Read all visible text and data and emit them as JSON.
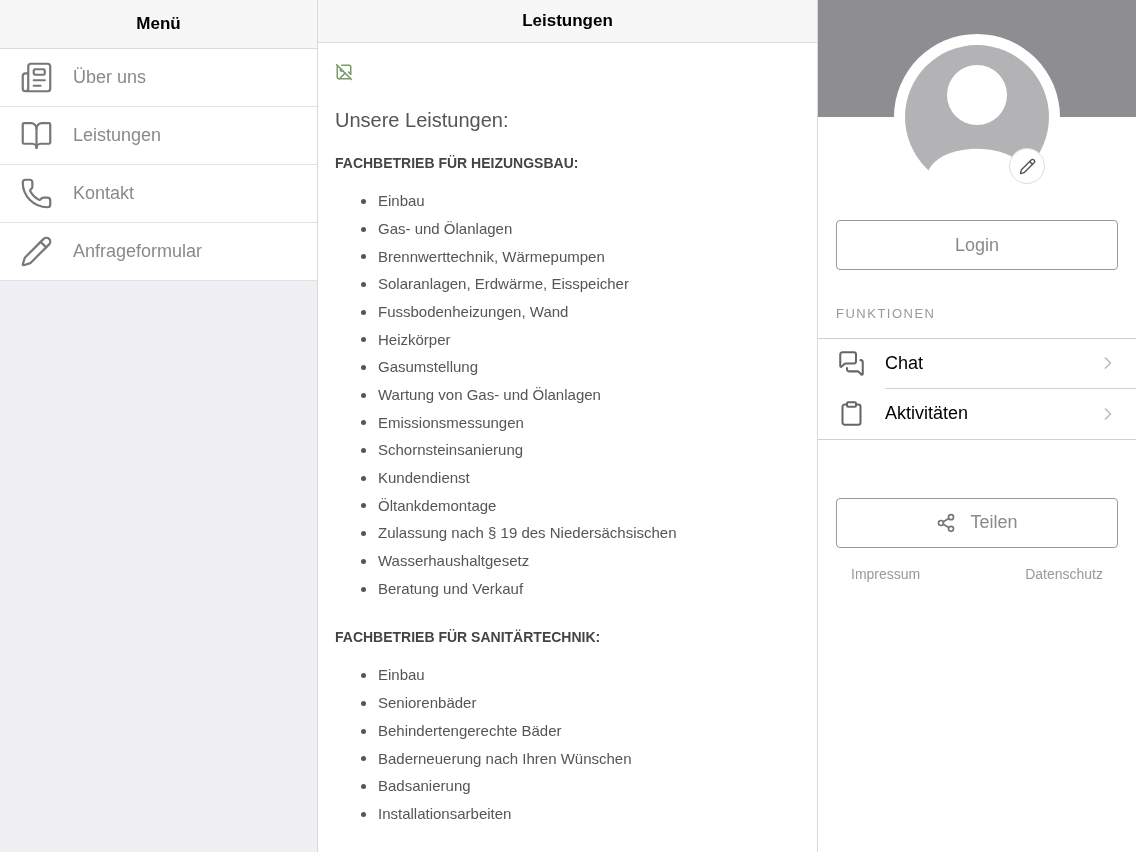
{
  "menu": {
    "title": "Menü",
    "items": [
      {
        "label": "Über uns"
      },
      {
        "label": "Leistungen"
      },
      {
        "label": "Kontakt"
      },
      {
        "label": "Anfrageformular"
      }
    ]
  },
  "content": {
    "title": "Leistungen",
    "heading": "Unsere Leistungen:",
    "sections": [
      {
        "title": "FACHBETRIEB FÜR HEIZUNGSBAU:",
        "items": [
          "Einbau",
          "Gas- und Ölanlagen",
          "Brennwerttechnik, Wärmepumpen",
          "Solaranlagen, Erdwärme, Eisspeicher",
          "Fussbodenheizungen, Wand",
          "Heizkörper",
          "Gasumstellung",
          "Wartung von Gas- und Ölanlagen",
          "Emissionsmessungen",
          "Schornsteinsanierung",
          "Kundendienst",
          "Öltankdemontage",
          "Zulassung nach § 19 des Niedersächsischen",
          "Wasserhaushaltgesetz",
          "Beratung und Verkauf"
        ]
      },
      {
        "title": "FACHBETRIEB FÜR SANITÄRTECHNIK:",
        "items": [
          "Einbau",
          "Seniorenbäder",
          "Behindertengerechte Bäder",
          "Baderneuerung nach Ihren Wünschen",
          "Badsanierung",
          "Installationsarbeiten"
        ]
      }
    ]
  },
  "profile": {
    "login_button": "Login",
    "section_title": "FUNKTIONEN",
    "functions": [
      {
        "label": "Chat"
      },
      {
        "label": "Aktivitäten"
      }
    ],
    "share_button": "Teilen",
    "footer_links": [
      "Impressum",
      "Datenschutz"
    ]
  }
}
